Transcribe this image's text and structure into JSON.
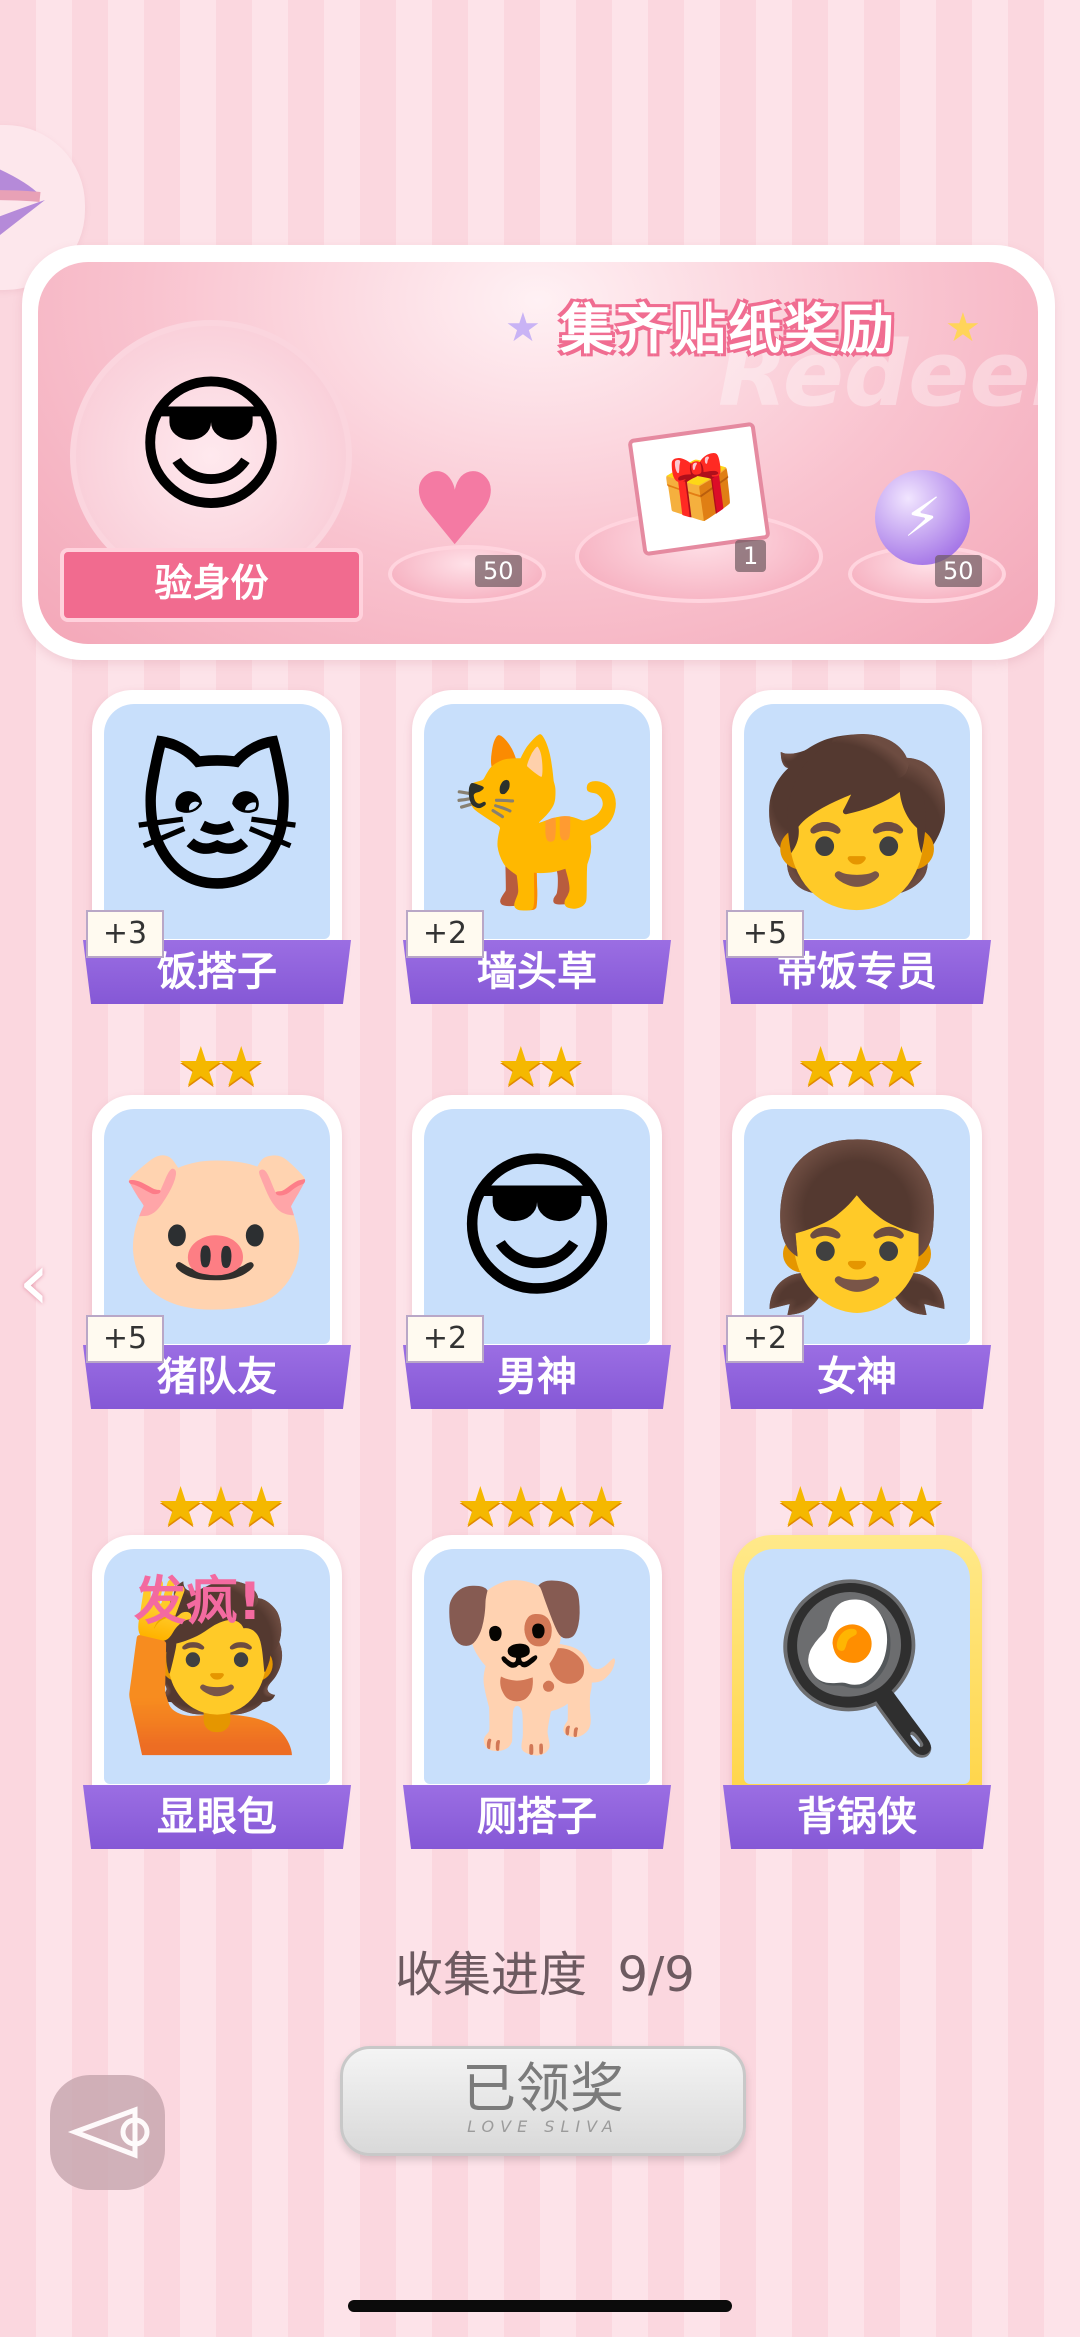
{
  "reward_panel": {
    "title": "集齐贴纸奖励",
    "watermark": "Redeem",
    "identity_button": "验身份",
    "rewards": [
      {
        "icon": "pink-heart-gem-icon",
        "count": "50"
      },
      {
        "icon": "gift-box-icon",
        "count": "1"
      },
      {
        "icon": "purple-lightning-orb-icon",
        "count": "50"
      }
    ]
  },
  "cards": [
    {
      "name": "饭搭子",
      "bonus": "+3",
      "stars": "",
      "icon": "cat-icon",
      "art": "🐱"
    },
    {
      "name": "墙头草",
      "bonus": "+2",
      "stars": "",
      "icon": "kitten-icon",
      "art": "🐈"
    },
    {
      "name": "带饭专员",
      "bonus": "+5",
      "stars": "",
      "icon": "girl-with-phone-icon",
      "art": "🧒"
    },
    {
      "name": "猪队友",
      "bonus": "+5",
      "stars": "★★",
      "icon": "pig-icon",
      "art": "🐷"
    },
    {
      "name": "男神",
      "bonus": "+2",
      "stars": "★★",
      "icon": "cool-boy-icon",
      "art": "😎"
    },
    {
      "name": "女神",
      "bonus": "+2",
      "stars": "★★★",
      "icon": "girl-icon",
      "art": "👧"
    },
    {
      "name": "显眼包",
      "bonus": "",
      "stars": "★★★",
      "icon": "crazy-girl-icon",
      "art": "🙋",
      "art_text": "发疯!"
    },
    {
      "name": "厕搭子",
      "bonus": "",
      "stars": "★★★★",
      "icon": "shiba-toilet-paper-icon",
      "art": "🐕"
    },
    {
      "name": "背锅侠",
      "bonus": "",
      "stars": "★★★★",
      "icon": "capybara-pan-icon",
      "art": "🍳"
    }
  ],
  "progress": {
    "label": "收集进度",
    "value": "9/9"
  },
  "claim_button": {
    "label": "已领奖",
    "sub": "LOVE SLIVA"
  },
  "colors": {
    "accent": "#f16b8f",
    "card_banner": "#8c5ddb",
    "star": "#f5b800"
  }
}
